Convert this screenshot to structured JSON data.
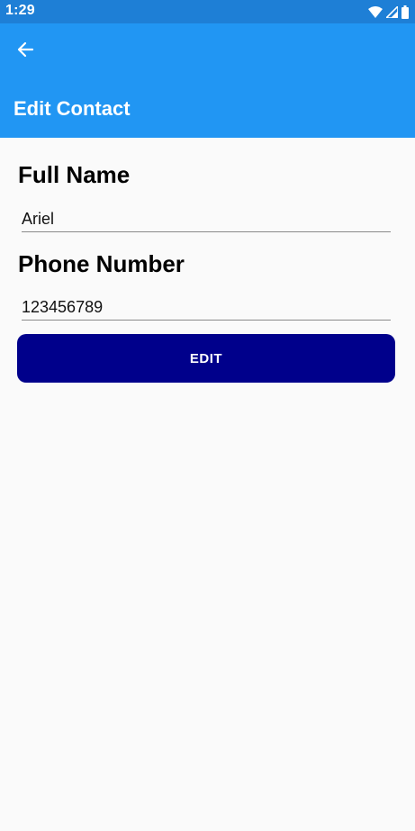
{
  "status_bar": {
    "time": "1:29",
    "icons": [
      "wifi-icon",
      "signal-icon",
      "battery-icon"
    ]
  },
  "app_bar": {
    "back_icon": "arrow-back-icon",
    "title": "Edit Contact"
  },
  "form": {
    "full_name_label": "Full Name",
    "full_name_value": "Ariel",
    "phone_label": "Phone Number",
    "phone_value": "123456789",
    "edit_button_label": "EDIT"
  },
  "colors": {
    "status_bar": "#1e7fd6",
    "app_bar": "#2196f3",
    "button": "#00008b",
    "background": "#fafafa"
  }
}
